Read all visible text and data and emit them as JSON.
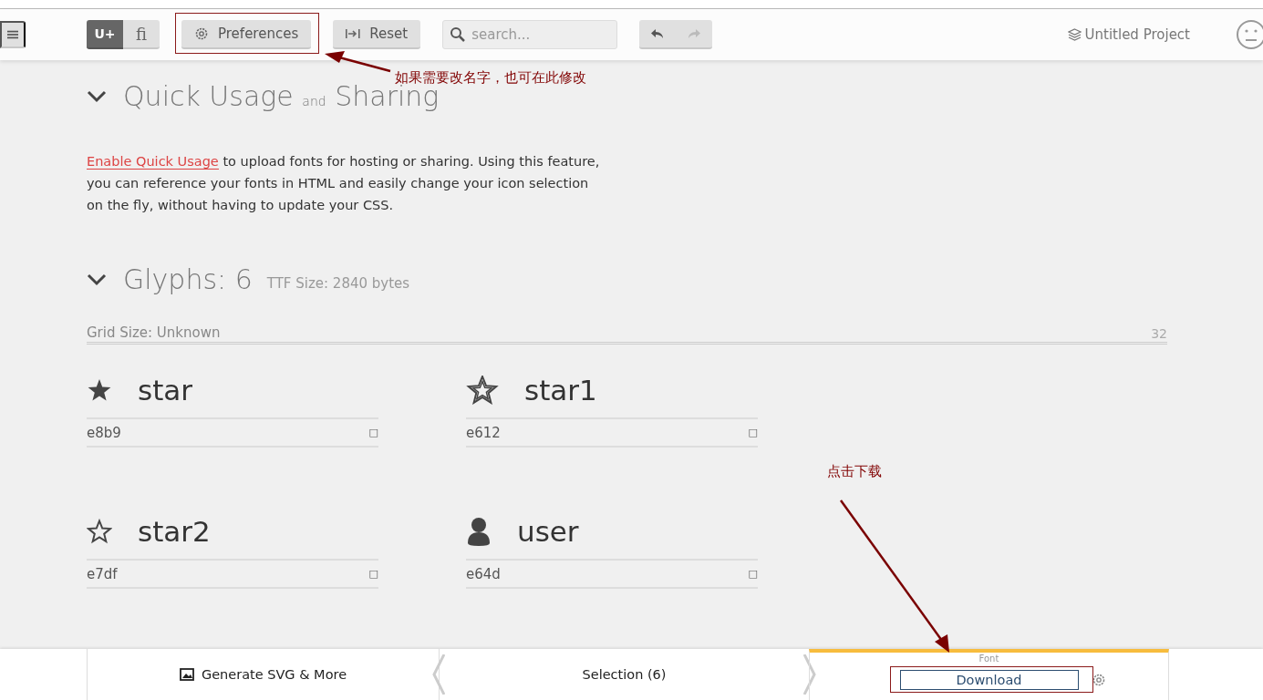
{
  "toolbar": {
    "mode_toggle": [
      {
        "label": "U+",
        "selected": true
      },
      {
        "label": "ﬁ",
        "selected": false
      }
    ],
    "preferences_button": "Preferences",
    "reset_button": "Reset",
    "search": {
      "placeholder": "search..."
    },
    "project_name": "Untitled Project"
  },
  "quick_usage": {
    "title_start": "Quick Usage",
    "title_and": "and",
    "title_end": "Sharing",
    "link": "Enable Quick Usage",
    "text": " to upload fonts for hosting or sharing. Using this feature, you can reference your fonts in HTML and easily change your icon selection on the fly, without having to update your CSS."
  },
  "glyphs": {
    "title": "Glyphs: 6",
    "ttf_size": "TTF Size: 2840 bytes",
    "grid_size": "Grid Size: Unknown",
    "grid_value": "32",
    "items": [
      {
        "kind": "star-solid",
        "name": "star",
        "code": "e8b9",
        "mark": "□"
      },
      {
        "kind": "star-double",
        "name": "star1",
        "code": "e612",
        "mark": "□"
      },
      {
        "kind": "star-outline",
        "name": "star2",
        "code": "e7df",
        "mark": "□"
      },
      {
        "kind": "user",
        "name": "user",
        "code": "e64d",
        "mark": "□"
      }
    ]
  },
  "bottom_bar": {
    "generate": "Generate SVG & More",
    "selection": "Selection (6)",
    "font_label": "Font",
    "download": "Download"
  },
  "annotations": [
    {
      "text": "如果需要改名字，也可在此修改"
    },
    {
      "text": "点击下载"
    }
  ]
}
